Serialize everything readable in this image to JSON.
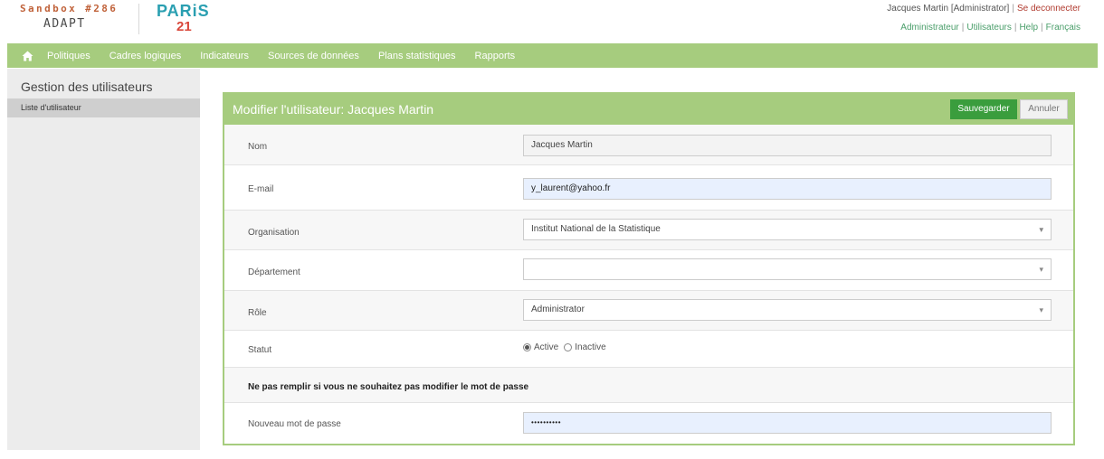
{
  "header": {
    "sandbox": "Sandbox #286",
    "adapt": "ADAPT",
    "paris": "PARiS",
    "paris21": "21",
    "user": "Jacques Martin [Administrator]",
    "logout": "Se deconnecter",
    "links": [
      "Administrateur",
      "Utilisateurs",
      "Help",
      "Français"
    ]
  },
  "nav": {
    "home_icon": "home-icon",
    "items": [
      "Politiques",
      "Cadres logiques",
      "Indicateurs",
      "Sources de données",
      "Plans statistiques",
      "Rapports"
    ]
  },
  "sidebar": {
    "title": "Gestion des utilisateurs",
    "items": [
      {
        "label": "Liste d'utilisateur"
      }
    ]
  },
  "panel": {
    "title": "Modifier l'utilisateur: Jacques Martin",
    "save": "Sauvegarder",
    "cancel": "Annuler"
  },
  "form": {
    "nom": {
      "label": "Nom",
      "value": "Jacques Martin"
    },
    "email": {
      "label": "E-mail",
      "value": "y_laurent@yahoo.fr"
    },
    "organisation": {
      "label": "Organisation",
      "value": "Institut National de la Statistique"
    },
    "departement": {
      "label": "Département",
      "value": ""
    },
    "role": {
      "label": "Rôle",
      "value": "Administrator"
    },
    "statut": {
      "label": "Statut",
      "options": [
        "Active",
        "Inactive"
      ],
      "selected": "Active"
    },
    "password_note": "Ne pas remplir si vous ne souhaitez pas modifier le mot de passe",
    "password": {
      "label": "Nouveau mot de passe",
      "value": "••••••••••"
    }
  },
  "colors": {
    "accent_green": "#a6cc7e",
    "save_green": "#3a9d3d",
    "sandbox_orange": "#c0623a",
    "paris_blue": "#2a9fb1",
    "paris_red": "#d9473b"
  }
}
